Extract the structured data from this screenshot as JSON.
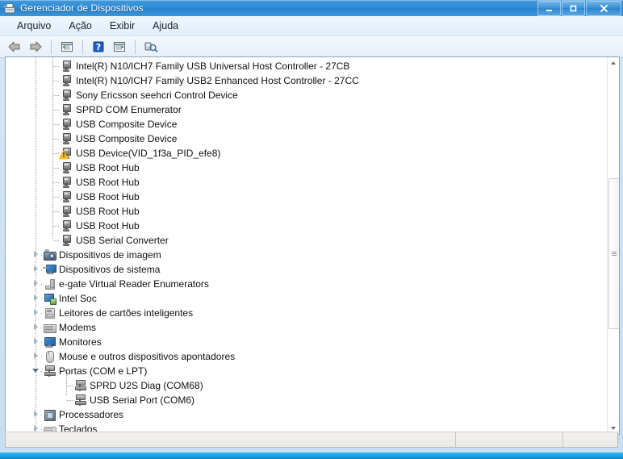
{
  "window": {
    "title": "Gerenciador de Dispositivos",
    "icon": "device-manager-icon",
    "buttons": {
      "minimize": "–",
      "maximize": "□",
      "close": "✕"
    }
  },
  "menubar": {
    "items": [
      {
        "label": "Arquivo",
        "name": "menu-arquivo"
      },
      {
        "label": "Ação",
        "name": "menu-acao"
      },
      {
        "label": "Exibir",
        "name": "menu-exibir"
      },
      {
        "label": "Ajuda",
        "name": "menu-ajuda"
      }
    ]
  },
  "toolbar": {
    "buttons": [
      {
        "name": "back-arrow-icon",
        "glyph": "←"
      },
      {
        "name": "forward-arrow-icon",
        "glyph": "→"
      },
      {
        "name": "show-hide-console-tree-icon",
        "glyph": "▤"
      },
      {
        "name": "help-question-icon",
        "glyph": "?"
      },
      {
        "name": "properties-icon",
        "glyph": "▤"
      },
      {
        "name": "scan-for-hardware-changes-icon",
        "glyph": "⌕"
      }
    ]
  },
  "tree": {
    "rows": [
      {
        "label": "Intel(R) N10/ICH7 Family USB Universal Host Controller - 27CB",
        "icon": "usb-controller-icon",
        "depth": 2,
        "twisty": "none",
        "warning": false
      },
      {
        "label": "Intel(R) N10/ICH7 Family USB2 Enhanced Host Controller - 27CC",
        "icon": "usb-controller-icon",
        "depth": 2,
        "twisty": "none",
        "warning": false
      },
      {
        "label": "Sony Ericsson seehcri Control Device",
        "icon": "usb-controller-icon",
        "depth": 2,
        "twisty": "none",
        "warning": false
      },
      {
        "label": "SPRD COM Enumerator",
        "icon": "usb-controller-icon",
        "depth": 2,
        "twisty": "none",
        "warning": false
      },
      {
        "label": "USB Composite Device",
        "icon": "usb-controller-icon",
        "depth": 2,
        "twisty": "none",
        "warning": false
      },
      {
        "label": "USB Composite Device",
        "icon": "usb-controller-icon",
        "depth": 2,
        "twisty": "none",
        "warning": false
      },
      {
        "label": "USB Device(VID_1f3a_PID_efe8)",
        "icon": "usb-controller-icon",
        "depth": 2,
        "twisty": "none",
        "warning": true
      },
      {
        "label": "USB Root Hub",
        "icon": "usb-controller-icon",
        "depth": 2,
        "twisty": "none",
        "warning": false
      },
      {
        "label": "USB Root Hub",
        "icon": "usb-controller-icon",
        "depth": 2,
        "twisty": "none",
        "warning": false
      },
      {
        "label": "USB Root Hub",
        "icon": "usb-controller-icon",
        "depth": 2,
        "twisty": "none",
        "warning": false
      },
      {
        "label": "USB Root Hub",
        "icon": "usb-controller-icon",
        "depth": 2,
        "twisty": "none",
        "warning": false
      },
      {
        "label": "USB Root Hub",
        "icon": "usb-controller-icon",
        "depth": 2,
        "twisty": "none",
        "warning": false
      },
      {
        "label": "USB Serial Converter",
        "icon": "usb-controller-icon",
        "depth": 2,
        "twisty": "none",
        "warning": false
      },
      {
        "label": "Dispositivos de imagem",
        "icon": "imaging-devices-icon",
        "depth": 1,
        "twisty": "collapsed",
        "warning": false
      },
      {
        "label": "Dispositivos de sistema",
        "icon": "system-devices-icon",
        "depth": 1,
        "twisty": "collapsed",
        "warning": false
      },
      {
        "label": "e-gate Virtual Reader Enumerators",
        "icon": "enumerator-icon",
        "depth": 1,
        "twisty": "collapsed",
        "warning": false
      },
      {
        "label": "Intel Soc",
        "icon": "intel-soc-icon",
        "depth": 1,
        "twisty": "collapsed",
        "warning": false
      },
      {
        "label": "Leitores de cartões inteligentes",
        "icon": "smart-card-reader-icon",
        "depth": 1,
        "twisty": "collapsed",
        "warning": false
      },
      {
        "label": "Modems",
        "icon": "modem-icon",
        "depth": 1,
        "twisty": "collapsed",
        "warning": false
      },
      {
        "label": "Monitores",
        "icon": "monitor-icon",
        "depth": 1,
        "twisty": "collapsed",
        "warning": false
      },
      {
        "label": "Mouse e outros dispositivos apontadores",
        "icon": "mouse-icon",
        "depth": 1,
        "twisty": "collapsed",
        "warning": false
      },
      {
        "label": "Portas (COM e LPT)",
        "icon": "port-icon",
        "depth": 1,
        "twisty": "expanded",
        "warning": false
      },
      {
        "label": "SPRD U2S Diag (COM68)",
        "icon": "port-icon",
        "depth": 2,
        "twisty": "none",
        "warning": false
      },
      {
        "label": "USB Serial Port (COM6)",
        "icon": "port-icon",
        "depth": 2,
        "twisty": "none",
        "warning": false
      },
      {
        "label": "Processadores",
        "icon": "processor-icon",
        "depth": 1,
        "twisty": "collapsed",
        "warning": false
      },
      {
        "label": "Teclados",
        "icon": "keyboard-icon",
        "depth": 1,
        "twisty": "collapsed",
        "warning": false
      }
    ]
  },
  "scrollbar": {
    "up_arrow": "scroll-up-arrow",
    "down_arrow": "scroll-down-arrow",
    "thumb": "scroll-thumb"
  },
  "statusbar": {
    "cells": [
      "",
      "",
      ""
    ]
  },
  "colors": {
    "title_bar": "#2f8bd3",
    "desktop": "#1f7fd0",
    "window_chrome": "#cfe2f5",
    "list_bg": "#ffffff",
    "warning": "#f2c021",
    "text": "#101010"
  }
}
